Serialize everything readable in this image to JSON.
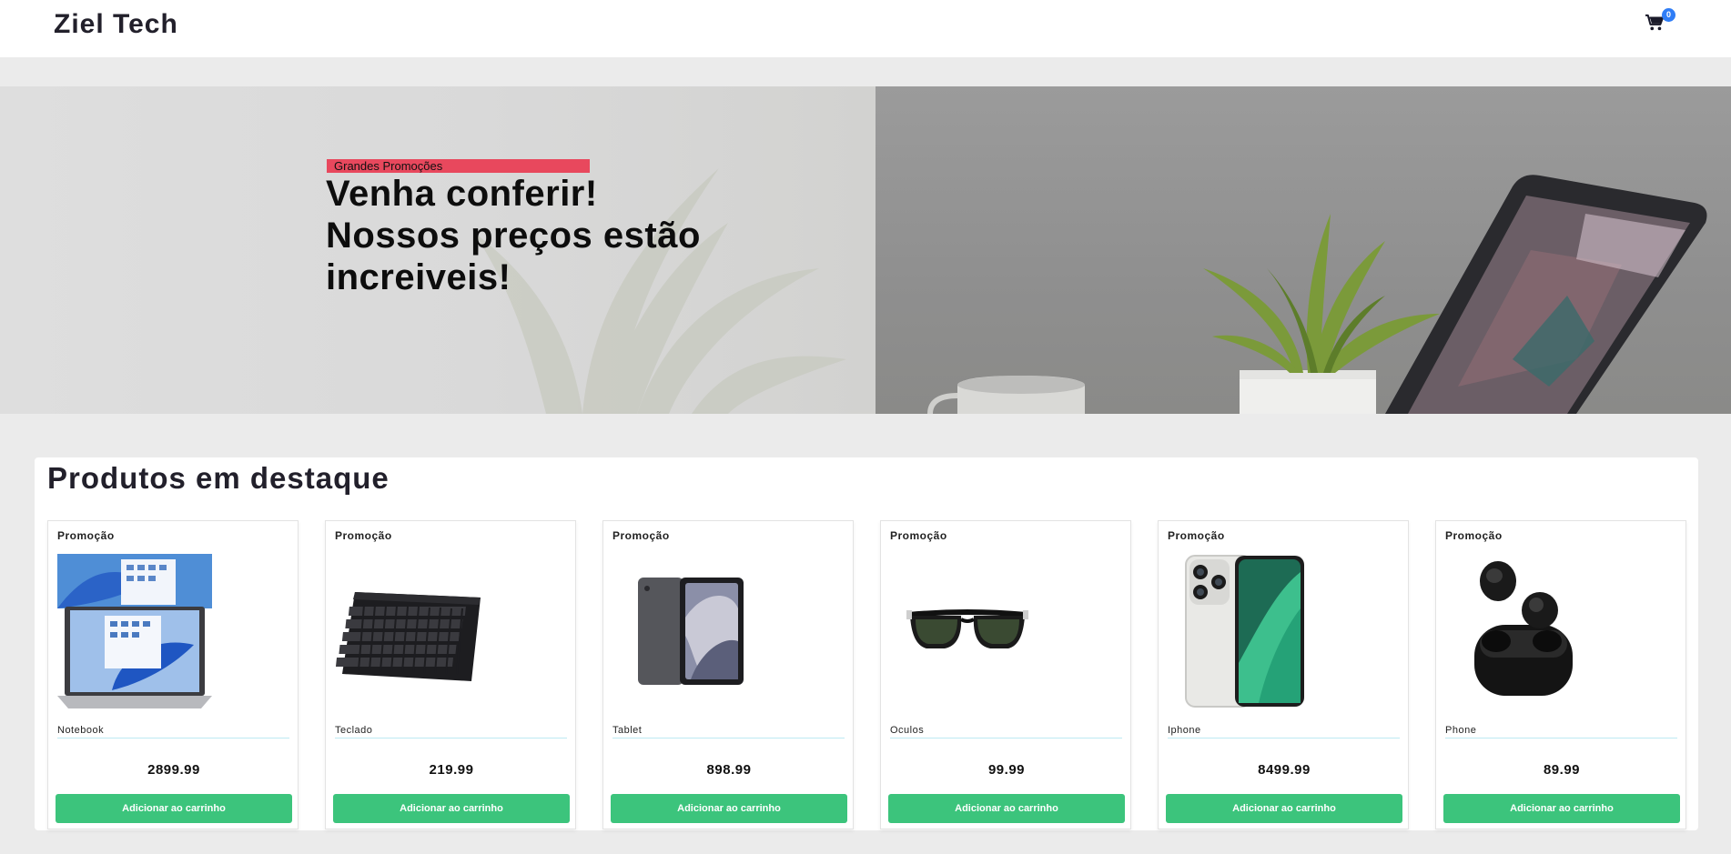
{
  "header": {
    "logo": "Ziel Tech",
    "cart_count": "0"
  },
  "hero": {
    "tag": "Grandes Promoções",
    "headline": "Venha conferir! Nossos preços estão increiveis!"
  },
  "featured": {
    "title": "Produtos em destaque",
    "products": [
      {
        "badge": "Promoção",
        "name": "Notebook",
        "price": "2899.99",
        "button": "Adicionar ao carrinho"
      },
      {
        "badge": "Promoção",
        "name": "Teclado",
        "price": "219.99",
        "button": "Adicionar ao carrinho"
      },
      {
        "badge": "Promoção",
        "name": "Tablet",
        "price": "898.99",
        "button": "Adicionar ao carrinho"
      },
      {
        "badge": "Promoção",
        "name": "Oculos",
        "price": "99.99",
        "button": "Adicionar ao carrinho"
      },
      {
        "badge": "Promoção",
        "name": "Iphone",
        "price": "8499.99",
        "button": "Adicionar ao carrinho"
      },
      {
        "badge": "Promoção",
        "name": "Phone",
        "price": "89.99",
        "button": "Adicionar ao carrinho"
      }
    ]
  },
  "colors": {
    "accent_tag": "#e8485d",
    "button": "#3cc47c",
    "badge": "#2f7df6"
  }
}
